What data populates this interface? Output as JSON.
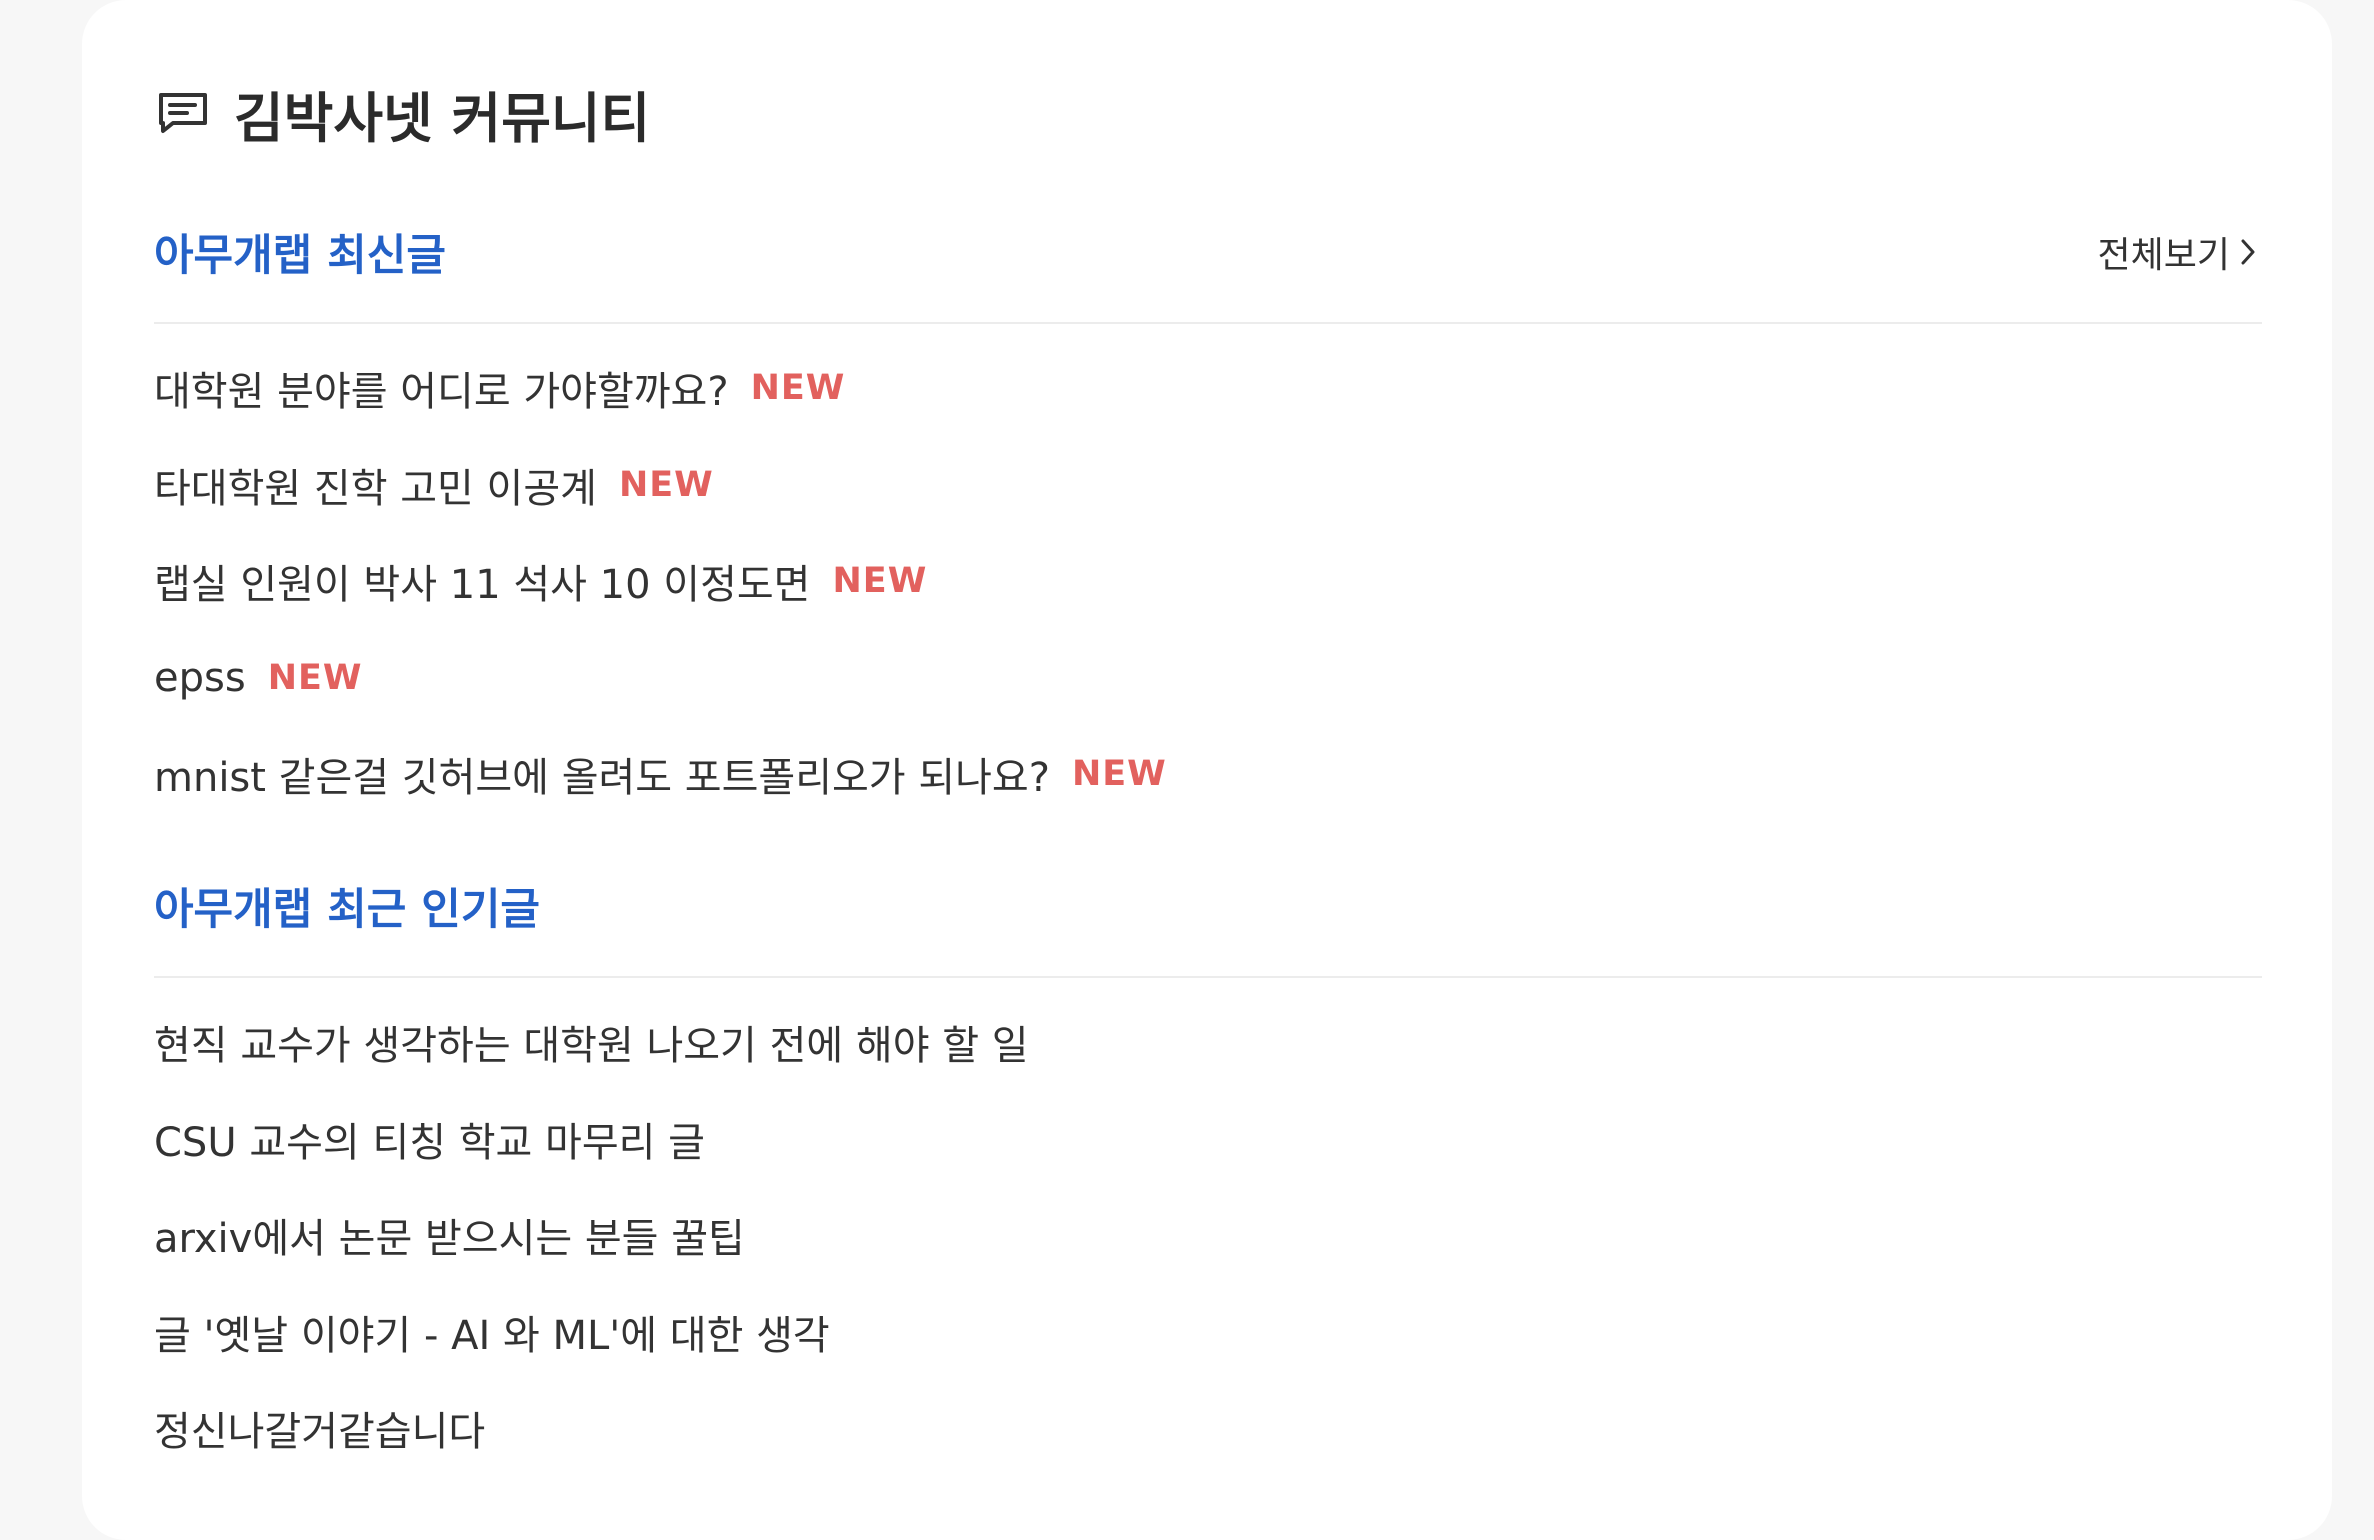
{
  "card": {
    "title": "김박사넷 커뮤니티",
    "icon": "chat-icon"
  },
  "latest": {
    "title": "아무개랩 최신글",
    "view_all": "전체보기",
    "new_label": "NEW",
    "posts": [
      {
        "title": "대학원 분야를 어디로 가야할까요?",
        "is_new": true
      },
      {
        "title": "타대학원 진학 고민 이공계",
        "is_new": true
      },
      {
        "title": "랩실 인원이 박사 11 석사 10 이정도면",
        "is_new": true
      },
      {
        "title": "epss",
        "is_new": true
      },
      {
        "title": "mnist 같은걸 깃허브에 올려도 포트폴리오가 되나요?",
        "is_new": true
      }
    ]
  },
  "popular": {
    "title": "아무개랩 최근 인기글",
    "posts": [
      {
        "title": "현직 교수가 생각하는 대학원 나오기 전에 해야 할 일"
      },
      {
        "title": "CSU 교수의 티칭 학교 마무리 글"
      },
      {
        "title": "arxiv에서 논문 받으시는 분들 꿀팁"
      },
      {
        "title": "글 '옛날 이야기 - AI 와 ML'에 대한 생각"
      },
      {
        "title": "정신나갈거같습니다"
      }
    ]
  },
  "colors": {
    "accent": "#2461c7",
    "new_badge": "#e2615e",
    "text": "#333333",
    "background": "#f7f7f7",
    "card": "#ffffff"
  }
}
